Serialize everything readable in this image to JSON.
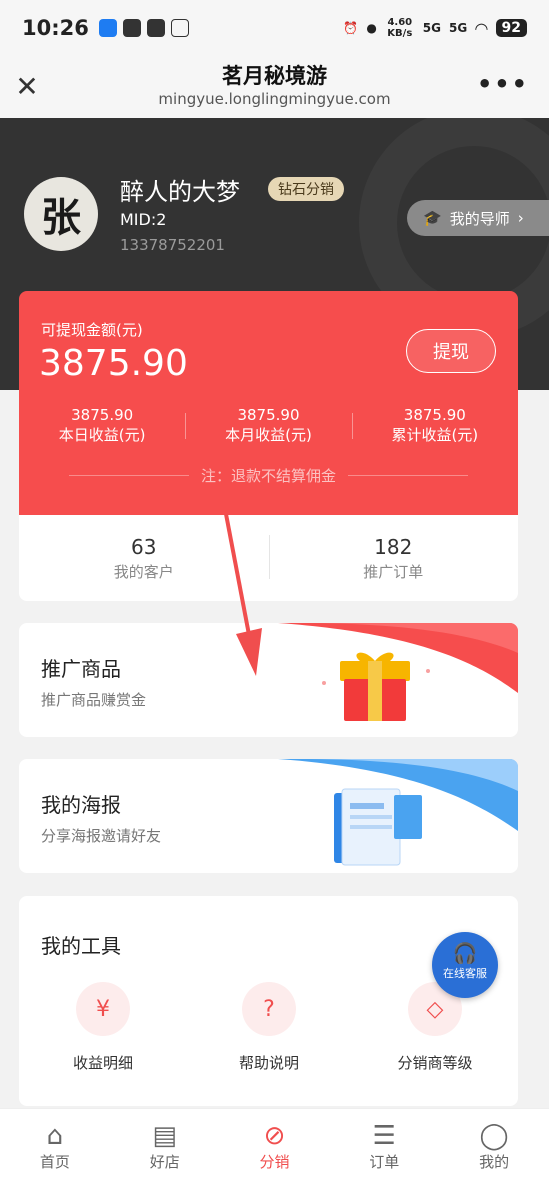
{
  "status_bar": {
    "time": "10:26",
    "net_speed": "4.60 KB/s",
    "sig1": "5G",
    "sig2": "5G",
    "battery": "92"
  },
  "navbar": {
    "close_icon": "close-icon",
    "title": "茗月秘境游",
    "url": "mingyue.longlingmingyue.com",
    "more": "•••"
  },
  "user": {
    "avatar_text": "张",
    "name": "醉人的大梦",
    "badge": "钻石分销",
    "mid": "MID:2",
    "phone": "13378752201",
    "mentor_label": "我的导师"
  },
  "earnings": {
    "withdrawable_label": "可提现金额(元)",
    "withdrawable_amount": "3875.90",
    "withdraw_button": "提现",
    "stats": [
      {
        "value": "3875.90",
        "label": "本日收益(元)"
      },
      {
        "value": "3875.90",
        "label": "本月收益(元)"
      },
      {
        "value": "3875.90",
        "label": "累计收益(元)"
      }
    ],
    "note": "注：退款不结算佣金"
  },
  "counts": [
    {
      "value": "63",
      "label": "我的客户"
    },
    {
      "value": "182",
      "label": "推广订单"
    }
  ],
  "promos": [
    {
      "title": "推广商品",
      "subtitle": "推广商品赚赏金"
    },
    {
      "title": "我的海报",
      "subtitle": "分享海报邀请好友"
    }
  ],
  "tools": {
    "title": "我的工具",
    "items": [
      {
        "label": "收益明细",
        "icon": "yen-refresh-icon"
      },
      {
        "label": "帮助说明",
        "icon": "question-icon"
      },
      {
        "label": "分销商等级",
        "icon": "diamond-icon"
      }
    ]
  },
  "service_button": "在线客服",
  "tabs": [
    {
      "label": "首页",
      "icon": "home-icon",
      "active": false
    },
    {
      "label": "好店",
      "icon": "store-icon",
      "active": false
    },
    {
      "label": "分销",
      "icon": "distribution-icon",
      "active": true
    },
    {
      "label": "订单",
      "icon": "order-icon",
      "active": false
    },
    {
      "label": "我的",
      "icon": "user-icon",
      "active": false
    }
  ],
  "colors": {
    "accent": "#f64d4d",
    "hero_bg": "#333333",
    "badge": "#e6d7b5",
    "service": "#2a6fd6"
  }
}
